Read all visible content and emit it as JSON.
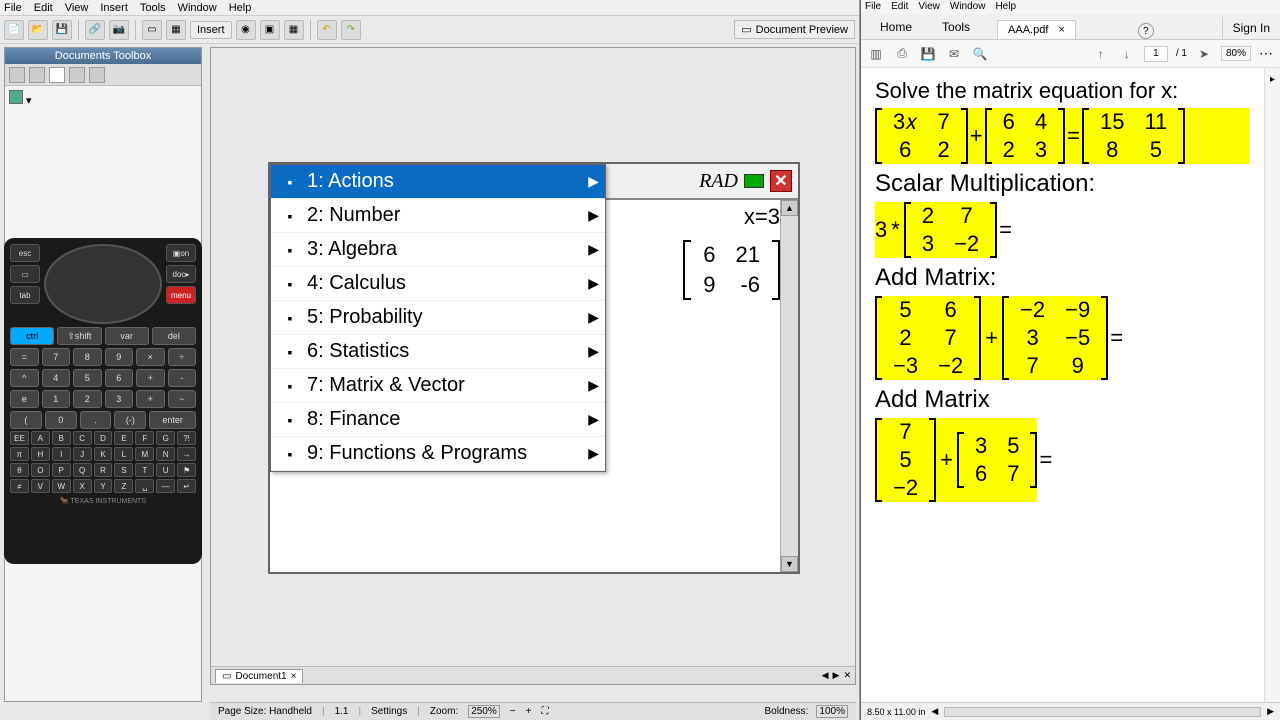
{
  "left": {
    "menu": [
      "File",
      "Edit",
      "View",
      "Insert",
      "Tools",
      "Window",
      "Help"
    ],
    "insert_label": "Insert",
    "doc_preview": "Document Preview",
    "sidebar_title": "Documents Toolbox",
    "doc_tab": "Document1"
  },
  "calc_keys": {
    "esc": "esc",
    "on": "▣on",
    "tab": "tab",
    "doc": "doc▸",
    "menu": "menu",
    "ctrl": "ctrl",
    "shift": "⇧shift",
    "var": "var",
    "del": "del",
    "row1": [
      "7",
      "8",
      "9"
    ],
    "row2": [
      "4",
      "5",
      "6"
    ],
    "row3": [
      "1",
      "2",
      "3"
    ],
    "row4": [
      "0",
      ".",
      "(-)"
    ],
    "ops1": [
      "×",
      "÷"
    ],
    "ops2": [
      "+",
      "-"
    ],
    "enter": "enter",
    "alpha1": [
      "EE",
      "A",
      "B",
      "C",
      "D",
      "E",
      "F",
      "G",
      "?!"
    ],
    "alpha2": [
      "π",
      "H",
      "I",
      "J",
      "K",
      "L",
      "M",
      "N",
      "→"
    ],
    "alpha3": [
      "θ",
      "O",
      "P",
      "Q",
      "R",
      "S",
      "T",
      "U",
      "⚑"
    ],
    "alpha4": [
      "≠",
      "V",
      "W",
      "X",
      "Y",
      "Z",
      "␣",
      "—",
      "↵"
    ],
    "brand": "🐂 TEXAS INSTRUMENTS"
  },
  "calc_screen": {
    "rad": "RAD",
    "result_var": "x=3",
    "matrix": [
      [
        "6",
        "21"
      ],
      [
        "9",
        "-6"
      ]
    ],
    "menu": [
      {
        "n": "1",
        "label": "Actions"
      },
      {
        "n": "2",
        "label": "Number"
      },
      {
        "n": "3",
        "label": "Algebra"
      },
      {
        "n": "4",
        "label": "Calculus"
      },
      {
        "n": "5",
        "label": "Probability"
      },
      {
        "n": "6",
        "label": "Statistics"
      },
      {
        "n": "7",
        "label": "Matrix & Vector"
      },
      {
        "n": "8",
        "label": "Finance"
      },
      {
        "n": "9",
        "label": "Functions & Programs"
      }
    ]
  },
  "status": {
    "page_size": "Page Size: Handheld",
    "ver": "1.1",
    "settings": "Settings",
    "zoom_label": "Zoom:",
    "zoom": "250%",
    "boldness": "Boldness:",
    "bold_val": "100%"
  },
  "pdf": {
    "menu": [
      "File",
      "Edit",
      "View",
      "Window",
      "Help"
    ],
    "tabs": {
      "home": "Home",
      "tools": "Tools"
    },
    "doc": "AAA.pdf",
    "signin": "Sign In",
    "page_current": "1",
    "page_total": "/ 1",
    "zoom": "80%",
    "footer_size": "8.50 x 11.00 in",
    "h1": "Solve the matrix equation for x:",
    "eq1": {
      "m1": [
        [
          "3𝑥",
          "7"
        ],
        [
          "6",
          "2"
        ]
      ],
      "m2": [
        [
          "6",
          "4"
        ],
        [
          "2",
          "3"
        ]
      ],
      "m3": [
        [
          "15",
          "11"
        ],
        [
          "8",
          "5"
        ]
      ]
    },
    "h2": "Scalar Multiplication:",
    "scalar": "3",
    "eq2_m": [
      [
        "2",
        "7"
      ],
      [
        "3",
        "−2"
      ]
    ],
    "h3": "Add Matrix:",
    "eq3": {
      "m1": [
        [
          "5",
          "6"
        ],
        [
          "2",
          "7"
        ],
        [
          "−3",
          "−2"
        ]
      ],
      "m2": [
        [
          "−2",
          "−9"
        ],
        [
          "3",
          "−5"
        ],
        [
          "7",
          "9"
        ]
      ]
    },
    "h4": "Add Matrix",
    "eq4": {
      "m1": [
        [
          "7"
        ],
        [
          "5"
        ],
        [
          "−2"
        ]
      ],
      "m2": [
        [
          "3",
          "5"
        ],
        [
          "6",
          "7"
        ]
      ]
    }
  }
}
